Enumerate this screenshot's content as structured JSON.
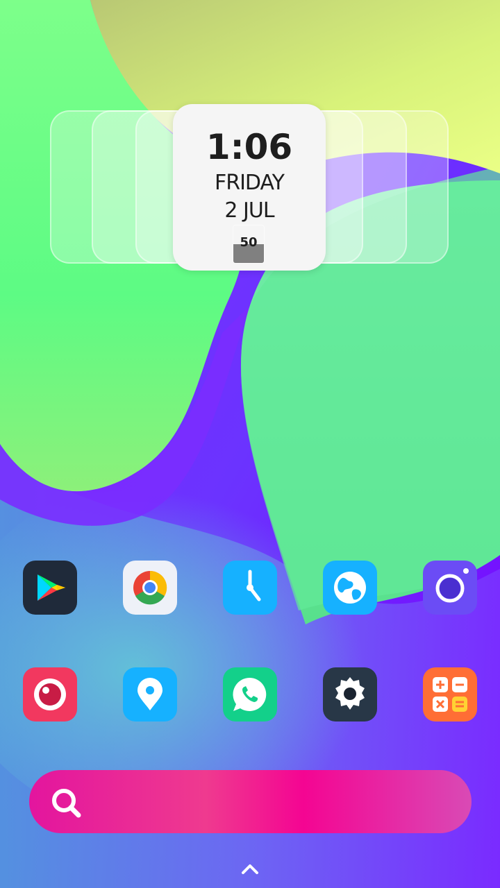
{
  "clock_widget": {
    "time": "1:06",
    "day": "FRIDAY",
    "date": "2 JUL",
    "battery_level": "50",
    "battery_fraction": 0.5
  },
  "apps": [
    {
      "name": "Play Store",
      "icon": "play-store-icon",
      "color": "#1f2a3a"
    },
    {
      "name": "Chrome",
      "icon": "chrome-icon",
      "color": "#eef1f8"
    },
    {
      "name": "Clock",
      "icon": "clock-icon",
      "color": "#16b1ff"
    },
    {
      "name": "Browser",
      "icon": "globe-icon",
      "color": "#16b1ff"
    },
    {
      "name": "Camera",
      "icon": "camera-icon",
      "color": "#6b4cf5"
    },
    {
      "name": "Gallery",
      "icon": "gallery-icon",
      "color": "#f2385f"
    },
    {
      "name": "Maps",
      "icon": "map-pin-icon",
      "color": "#16b1ff"
    },
    {
      "name": "WhatsApp",
      "icon": "whatsapp-icon",
      "color": "#13d08a"
    },
    {
      "name": "Settings",
      "icon": "gear-icon",
      "color": "#283747"
    },
    {
      "name": "Calculator",
      "icon": "calculator-icon",
      "color": "#ff6e35"
    }
  ],
  "search": {
    "icon": "search-icon"
  },
  "drawer": {
    "icon": "chevron-up-icon"
  },
  "colors": {
    "accent_pink": "#e3159e",
    "wallpaper_green": "#6cff8a",
    "wallpaper_purple": "#7a12ff"
  }
}
